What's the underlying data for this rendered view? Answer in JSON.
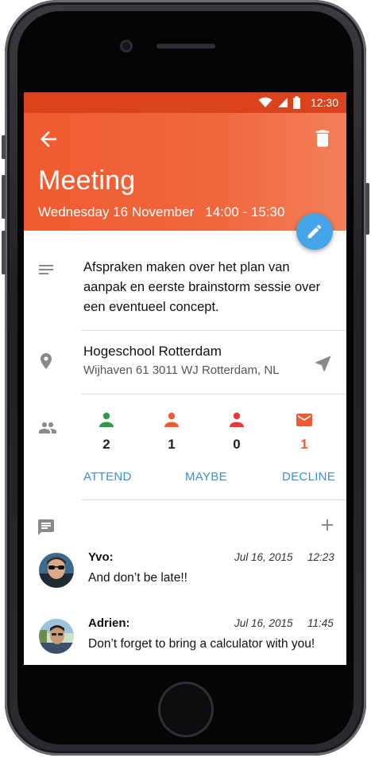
{
  "status_bar": {
    "time": "12:30"
  },
  "event": {
    "title": "Meeting",
    "date": "Wednesday 16 November",
    "time_range": "14:00 - 15:30",
    "description": "Afspraken maken over het plan van aanpak en eerste brainstorm sessie over een eventueel concept."
  },
  "location": {
    "name": "Hogeschool Rotterdam",
    "address": "Wijhaven 61 3011 WJ Rotterdam, NL"
  },
  "attendance": {
    "attending_count": "2",
    "maybe_count": "1",
    "declined_count": "0",
    "invited_count": "1"
  },
  "actions": {
    "attend": "ATTEND",
    "maybe": "MAYBE",
    "decline": "DECLINE"
  },
  "comments": [
    {
      "author": "Yvo:",
      "date": "Jul 16, 2015",
      "time": "12:23",
      "text": "And don’t be late!!"
    },
    {
      "author": "Adrien:",
      "date": "Jul 16, 2015",
      "time": "11:45",
      "text": "Don’t forget to bring a calculator with you!"
    }
  ],
  "colors": {
    "accent": "#f05b31",
    "fab": "#45a5e8",
    "attending": "#2e9a47",
    "maybe": "#f05b31",
    "declined": "#e53935",
    "link": "#3a8fd6"
  },
  "icons": {
    "back": "arrow-left-icon",
    "delete": "trash-icon",
    "edit": "pencil-icon",
    "description": "notes-icon",
    "location": "map-pin-icon",
    "navigate": "navigation-arrow-icon",
    "people": "people-icon",
    "comments": "comment-icon",
    "add": "plus-icon"
  }
}
